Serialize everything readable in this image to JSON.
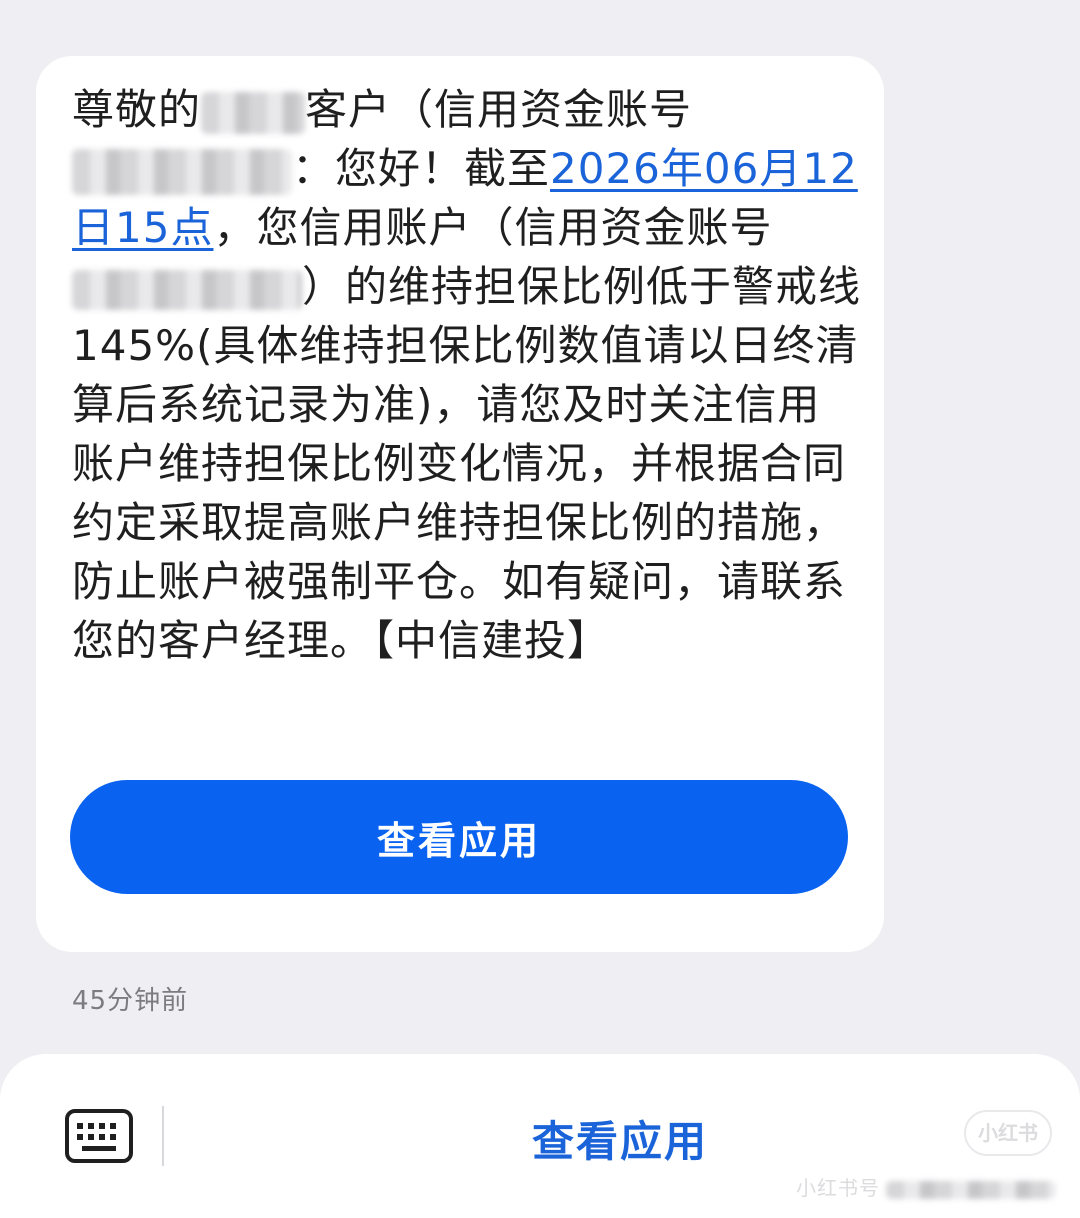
{
  "message": {
    "part1": "尊敬的",
    "part2": "客户（信用资金账号",
    "part3": "：您好！截至",
    "date_link": "2026年06月12日15点",
    "part4": "，您信用账户（信用资金账号",
    "part5": "）的维持担保比例低于警戒线145%(具体维持担保比例数值请以日终清算后系统记录为准)，请您及时关注信用账户维持担保比例变化情况，并根据合同约定采取提高账户维持担保比例的措施，防止账户被强制平仓。如有疑问，请联系您的客户经理。【中信建投】"
  },
  "action_button_label": "查看应用",
  "timestamp": "45分钟前",
  "bottom_bar": {
    "action_label": "查看应用",
    "keyboard_icon": "keyboard-icon"
  },
  "watermark": {
    "badge": "小红书",
    "text": "小红书号"
  },
  "colors": {
    "background": "#efeff3",
    "bubble": "#ffffff",
    "accent_blue": "#0a63f0",
    "link_blue": "#1a63d9"
  }
}
